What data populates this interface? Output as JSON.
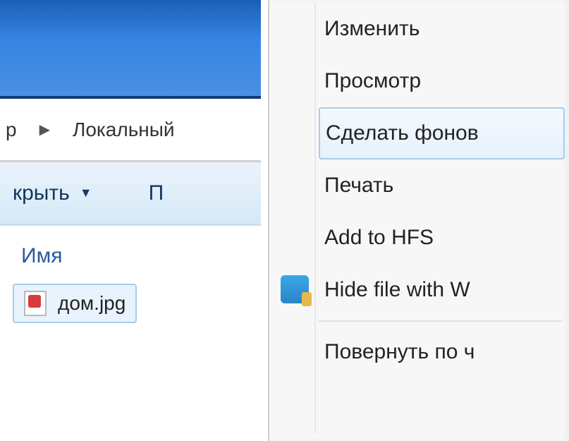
{
  "address": {
    "seg1": "р",
    "seg2": "Локальный"
  },
  "toolbar": {
    "open_label": "крыть",
    "other_label": "П"
  },
  "listing": {
    "column_name": "Имя",
    "file_name": "дом.jpg"
  },
  "context_menu": {
    "items": [
      {
        "label": "Изменить",
        "hover": false,
        "sep": false
      },
      {
        "label": "Просмотр",
        "hover": false,
        "sep": false
      },
      {
        "label": "Сделать фонов",
        "hover": true,
        "sep": false
      },
      {
        "label": "Печать",
        "hover": false,
        "sep": false
      },
      {
        "label": "Add to HFS",
        "hover": false,
        "sep": false
      },
      {
        "label": "Hide file with W",
        "hover": false,
        "icon": "folder-icon",
        "sep": true
      },
      {
        "label": "Повернуть по ч",
        "hover": false,
        "sep": false
      }
    ]
  }
}
